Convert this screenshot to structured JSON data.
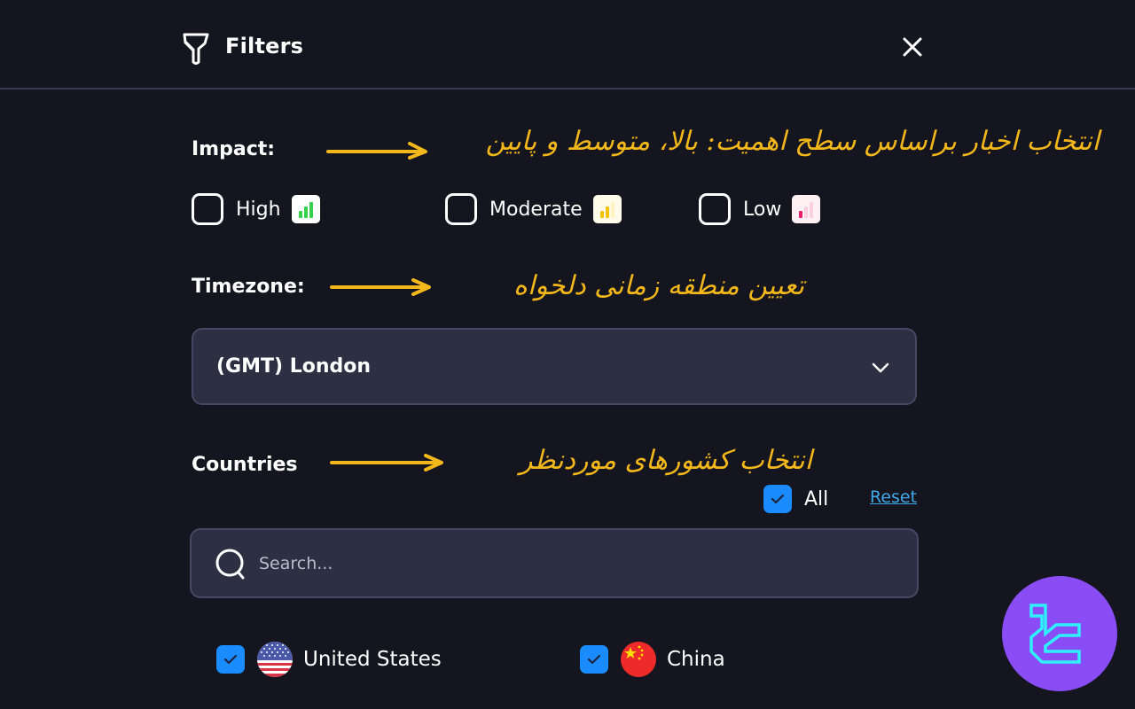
{
  "header": {
    "title": "Filters",
    "icon": "funnel-icon",
    "close_icon": "close-icon"
  },
  "impact": {
    "label": "Impact:",
    "options": [
      {
        "label": "High",
        "checked": false,
        "icon": "signal-bars-high-icon",
        "color": "#35d14a",
        "badge_bg": "#ffffff"
      },
      {
        "label": "Moderate",
        "checked": false,
        "icon": "signal-bars-moderate-icon",
        "color": "#f5c20b",
        "badge_bg": "#fffbe8"
      },
      {
        "label": "Low",
        "checked": false,
        "icon": "signal-bars-low-icon",
        "color": "#e81f6a",
        "badge_bg": "#fff0f4"
      }
    ],
    "annotation": "انتخاب اخبار براساس سطح اهمیت: بالا، متوسط و پایین"
  },
  "timezone": {
    "label": "Timezone:",
    "selected": "(GMT) London",
    "annotation": "تعیین منطقه زمانی دلخواه"
  },
  "countries": {
    "label": "Countries",
    "annotation": "انتخاب کشورهای موردنظر",
    "all_label": "All",
    "all_checked": true,
    "reset_label": "Reset",
    "search_placeholder": "Search...",
    "search_value": "",
    "items": [
      {
        "name": "United States",
        "checked": true,
        "flag": "us-flag-icon"
      },
      {
        "name": "China",
        "checked": true,
        "flag": "china-flag-icon"
      }
    ]
  },
  "colors": {
    "background": "#15151f",
    "accent_blue": "#1a8cff",
    "annotation_yellow": "#f2b71a",
    "link": "#3fa8e8",
    "logo_bg": "#8a4cf5",
    "logo_fg": "#2ff0ff"
  }
}
